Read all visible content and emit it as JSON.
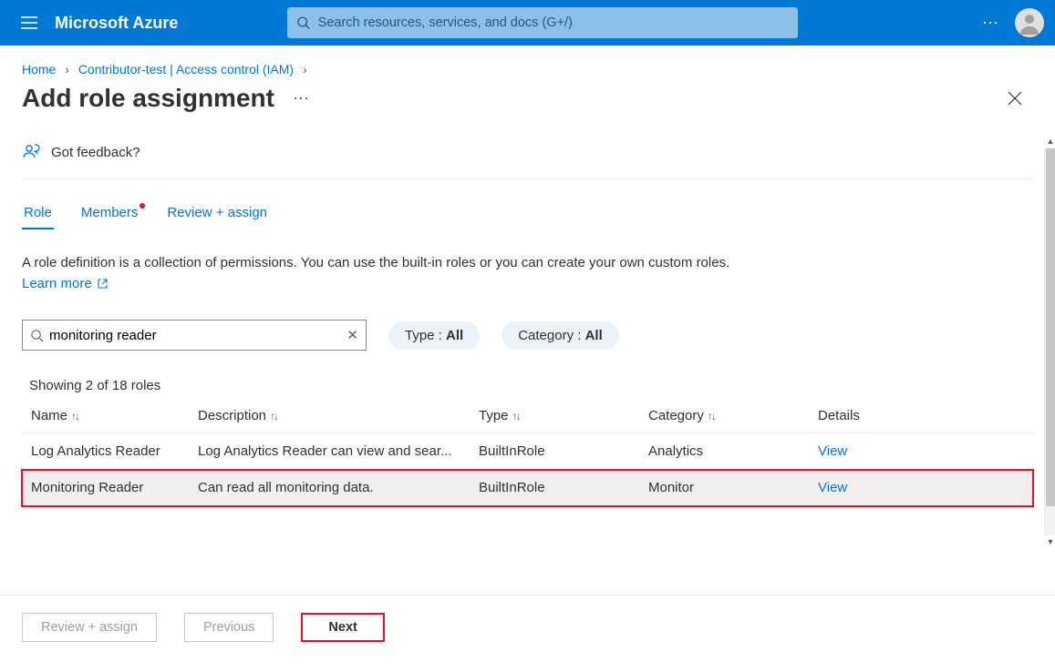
{
  "header": {
    "brand": "Microsoft Azure",
    "search_placeholder": "Search resources, services, and docs (G+/)"
  },
  "breadcrumb": {
    "items": [
      "Home",
      "Contributor-test | Access control (IAM)"
    ]
  },
  "page": {
    "title": "Add role assignment",
    "feedback_label": "Got feedback?"
  },
  "tabs": [
    {
      "label": "Role",
      "active": true,
      "dot": false
    },
    {
      "label": "Members",
      "active": false,
      "dot": true
    },
    {
      "label": "Review + assign",
      "active": false,
      "dot": false
    }
  ],
  "description": {
    "text": "A role definition is a collection of permissions. You can use the built-in roles or you can create your own custom roles. ",
    "learn_more": "Learn more"
  },
  "filters": {
    "search_value": "monitoring reader",
    "type_prefix": "Type : ",
    "type_value": "All",
    "category_prefix": "Category : ",
    "category_value": "All"
  },
  "results": {
    "count_label": "Showing 2 of 18 roles",
    "columns": [
      "Name",
      "Description",
      "Type",
      "Category",
      "Details"
    ],
    "rows": [
      {
        "name": "Log Analytics Reader",
        "description": "Log Analytics Reader can view and sear...",
        "type": "BuiltInRole",
        "category": "Analytics",
        "details": "View",
        "highlight": false
      },
      {
        "name": "Monitoring Reader",
        "description": "Can read all monitoring data.",
        "type": "BuiltInRole",
        "category": "Monitor",
        "details": "View",
        "highlight": true
      }
    ]
  },
  "footer": {
    "review_assign": "Review + assign",
    "previous": "Previous",
    "next": "Next"
  }
}
